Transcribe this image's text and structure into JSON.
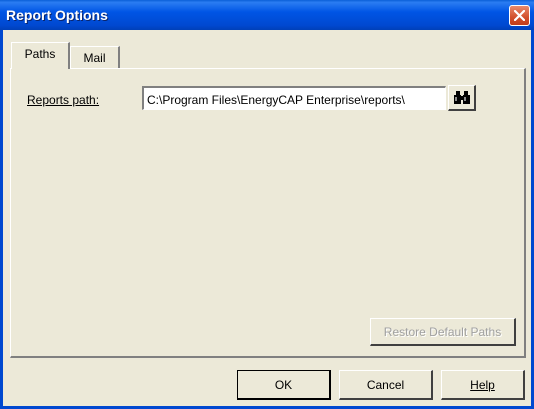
{
  "window": {
    "title": "Report Options"
  },
  "tabs": [
    {
      "label": "Paths",
      "selected": true
    },
    {
      "label": "Mail",
      "selected": false
    }
  ],
  "paths": {
    "reports_path_label": "Reports path:",
    "reports_path_value": "C:\\Program Files\\EnergyCAP Enterprise\\reports\\",
    "restore_defaults_label": "Restore Default Paths",
    "restore_defaults_enabled": false
  },
  "buttons": {
    "ok": "OK",
    "cancel": "Cancel",
    "help": "Help"
  },
  "icons": {
    "close": "close-icon",
    "browse": "binoculars-icon"
  },
  "colors": {
    "titlebar": "#0055e5",
    "close": "#d2502c",
    "face": "#ece9d8"
  }
}
